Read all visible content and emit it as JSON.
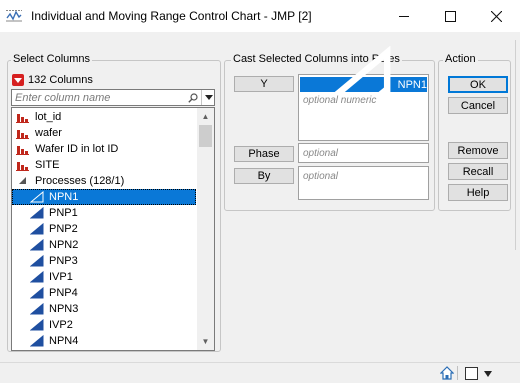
{
  "window": {
    "title": "Individual and Moving Range Control Chart - JMP [2]",
    "minimize_icon": "minimize-icon",
    "maximize_icon": "maximize-icon",
    "close_icon": "close-icon"
  },
  "select_columns": {
    "title": "Select Columns",
    "count_label": "132 Columns",
    "search_placeholder": "Enter column name",
    "columns": [
      {
        "label": "lot_id",
        "icon": "nominal-bar-icon",
        "selected": false
      },
      {
        "label": "wafer",
        "icon": "nominal-bar-icon",
        "selected": false
      },
      {
        "label": "Wafer ID in lot ID",
        "icon": "nominal-bar-icon",
        "selected": false
      },
      {
        "label": "SITE",
        "icon": "nominal-bar-icon",
        "selected": false
      },
      {
        "label": "Processes (128/1)",
        "icon": "group-collapse-icon",
        "selected": false
      },
      {
        "label": "NPN1",
        "icon": "continuous-triangle-icon",
        "selected": true
      },
      {
        "label": "PNP1",
        "icon": "continuous-triangle-icon",
        "selected": false
      },
      {
        "label": "PNP2",
        "icon": "continuous-triangle-icon",
        "selected": false
      },
      {
        "label": "NPN2",
        "icon": "continuous-triangle-icon",
        "selected": false
      },
      {
        "label": "PNP3",
        "icon": "continuous-triangle-icon",
        "selected": false
      },
      {
        "label": "IVP1",
        "icon": "continuous-triangle-icon",
        "selected": false
      },
      {
        "label": "PNP4",
        "icon": "continuous-triangle-icon",
        "selected": false
      },
      {
        "label": "NPN3",
        "icon": "continuous-triangle-icon",
        "selected": false
      },
      {
        "label": "IVP2",
        "icon": "continuous-triangle-icon",
        "selected": false
      },
      {
        "label": "NPN4",
        "icon": "continuous-triangle-icon",
        "selected": false
      }
    ]
  },
  "cast_roles": {
    "title": "Cast Selected Columns into Roles",
    "y_label": "Y",
    "y_value": "NPN1",
    "y_hint": "optional numeric",
    "phase_label": "Phase",
    "phase_hint": "optional",
    "by_label": "By",
    "by_hint": "optional"
  },
  "action": {
    "title": "Action",
    "ok": "OK",
    "cancel": "Cancel",
    "remove": "Remove",
    "recall": "Recall",
    "help": "Help"
  },
  "colors": {
    "selection": "#0a78d7",
    "nominal_icon": "#c0281c",
    "continuous_icon": "#1f4fa0"
  }
}
